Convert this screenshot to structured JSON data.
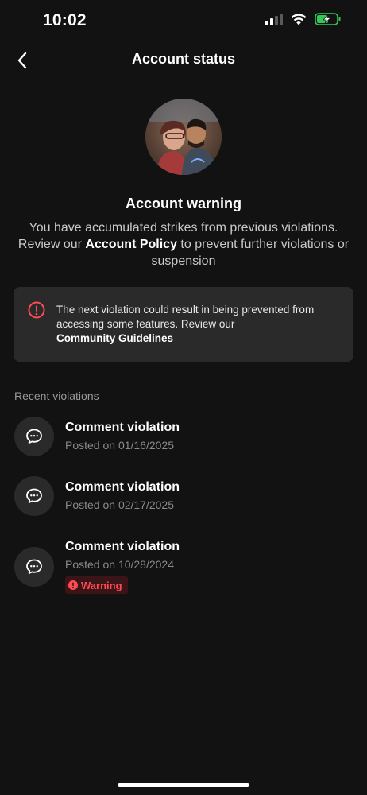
{
  "status_bar": {
    "time": "10:02",
    "signal_icon": "cellular-signal-icon",
    "wifi_icon": "wifi-icon",
    "battery_icon": "battery-charging-icon",
    "battery_color": "#34c759"
  },
  "header": {
    "back_icon": "chevron-left-icon",
    "title": "Account status"
  },
  "account": {
    "avatar_icon": "profile-photo",
    "warning_title": "Account warning",
    "desc_line1": "You have accumulated strikes from previous violations.",
    "desc_review": "Review our",
    "desc_policy_link": "Account Policy",
    "desc_rest": "to prevent further violations or suspension"
  },
  "notice": {
    "icon": "alert-circle-icon",
    "icon_color": "#ff4b54",
    "text": "The next violation could result in being prevented from accessing some features. Review our",
    "link": "Community Guidelines"
  },
  "violations": {
    "label": "Recent violations",
    "items": [
      {
        "icon": "comment-bubble-icon",
        "title": "Comment violation",
        "date": "Posted on 01/16/2025",
        "badge": ""
      },
      {
        "icon": "comment-bubble-icon",
        "title": "Comment violation",
        "date": "Posted on 02/17/2025",
        "badge": ""
      },
      {
        "icon": "comment-bubble-icon",
        "title": "Comment violation",
        "date": "Posted on 10/28/2024",
        "badge": "Warning",
        "badge_color": "#ff4b54"
      }
    ]
  }
}
